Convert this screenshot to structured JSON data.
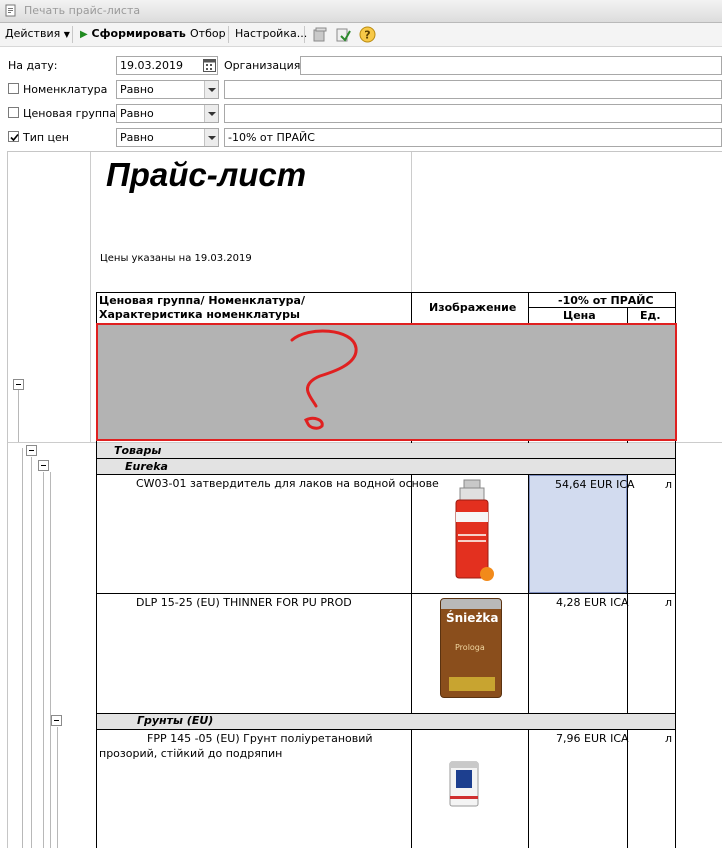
{
  "window": {
    "title": "Печать прайс-листа"
  },
  "toolbar": {
    "actions_label": "Действия",
    "generate_label": "Сформировать",
    "filter_label": "Отбор",
    "settings_label": "Настройка..."
  },
  "filters": {
    "date_label": "На дату:",
    "date_value": "19.03.2019",
    "org_label": "Организация:",
    "org_value": "",
    "nomenclature": {
      "label": "Номенклатура",
      "checked": false,
      "condition": "Равно",
      "value": ""
    },
    "price_group": {
      "label": "Ценовая группа",
      "checked": false,
      "condition": "Равно",
      "value": ""
    },
    "price_type": {
      "label": "Тип цен",
      "checked": true,
      "condition": "Равно",
      "value": "-10% от ПРАЙС"
    }
  },
  "report": {
    "title": "Прайс-лист",
    "subtitle": "Цены указаны на 19.03.2019",
    "header": {
      "col_name": "Ценовая группа/ Номенклатура/ Характеристика номенклатуры",
      "col_image": "Изображение",
      "price_type": "-10% от ПРАЙС",
      "col_price": "Цена",
      "col_unit": "Ед."
    },
    "groups": {
      "goods": "Товары",
      "eureka": "Eureka",
      "primers": "Грунты (EU)"
    },
    "items": [
      {
        "name": "CW03-01 затвердитель для  лаков на водной основе",
        "price": "54,64 EUR ICA",
        "unit": "л"
      },
      {
        "name": "DLP 15-25 (EU) THINNER FOR PU PROD",
        "price": "4,28 EUR ICA",
        "unit": "л",
        "brand": "Śnieżka",
        "sublabel": "Prologa"
      },
      {
        "name": "FPP 145 -05 (EU) Грунт поліуретановий прозорий, стійкий до подряпин",
        "price": "7,96 EUR ICA",
        "unit": "л"
      }
    ]
  },
  "colors": {
    "selected_price_cell": "#d2dbef",
    "grey_area": "#b3b3b3",
    "annotation": "#e02020"
  }
}
